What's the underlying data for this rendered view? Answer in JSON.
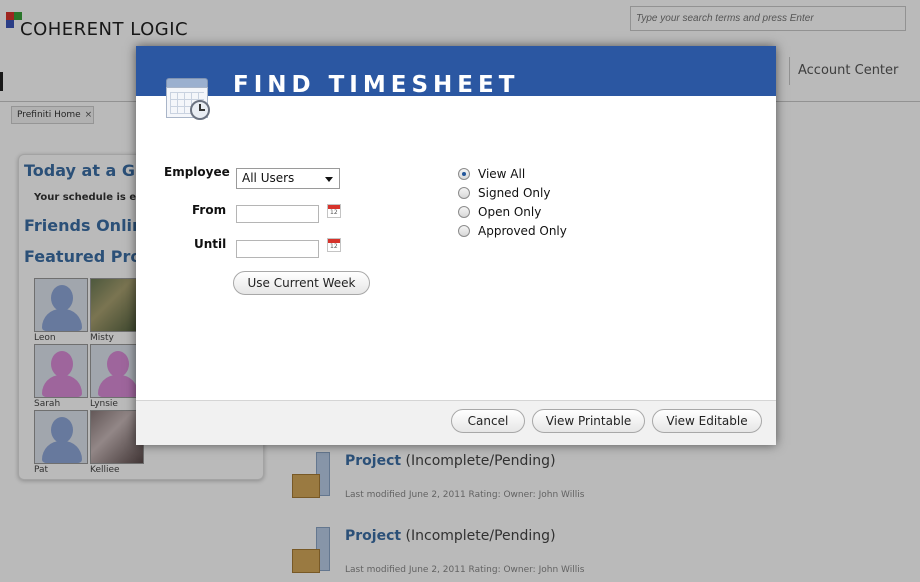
{
  "header": {
    "logo_text": "COHERENT LOGIC",
    "search_placeholder": "Type your search terms and press Enter",
    "account_center": "Account Center",
    "home_tab": "Prefiniti Home",
    "tab_close": "×"
  },
  "sidebar": {
    "today_heading": "Today at a Gl",
    "schedule_text": "Your schedule is em",
    "friends_heading": "Friends Onlin",
    "featured_heading": "Featured Prof",
    "profiles": [
      {
        "name": "Leon"
      },
      {
        "name": "Misty"
      },
      {
        "name": "Sarah"
      },
      {
        "name": "Lynsie"
      },
      {
        "name": "Pat"
      },
      {
        "name": "Kelliee"
      }
    ]
  },
  "projects": [
    {
      "title": "Project",
      "status": "(Incomplete/Pending)",
      "meta": "Last modified June 2, 2011 Rating: Owner: John Willis"
    },
    {
      "title": "Project",
      "status": "(Incomplete/Pending)",
      "meta": "Last modified June 2, 2011 Rating: Owner: John Willis"
    }
  ],
  "dialog": {
    "title": "FIND TIMESHEET",
    "employee_label": "Employee",
    "employee_value": "All Users",
    "from_label": "From",
    "until_label": "Until",
    "from_value": "",
    "until_value": "",
    "date_icon_number": "12",
    "use_current_week": "Use Current Week",
    "radios": [
      {
        "label": "View All",
        "checked": true
      },
      {
        "label": "Signed Only",
        "checked": false
      },
      {
        "label": "Open Only",
        "checked": false
      },
      {
        "label": "Approved Only",
        "checked": false
      }
    ],
    "buttons": {
      "cancel": "Cancel",
      "view_printable": "View Printable",
      "view_editable": "View Editable"
    }
  },
  "colors": {
    "dialog_header": "#2b57a2",
    "link_blue": "#3b6ea5"
  }
}
